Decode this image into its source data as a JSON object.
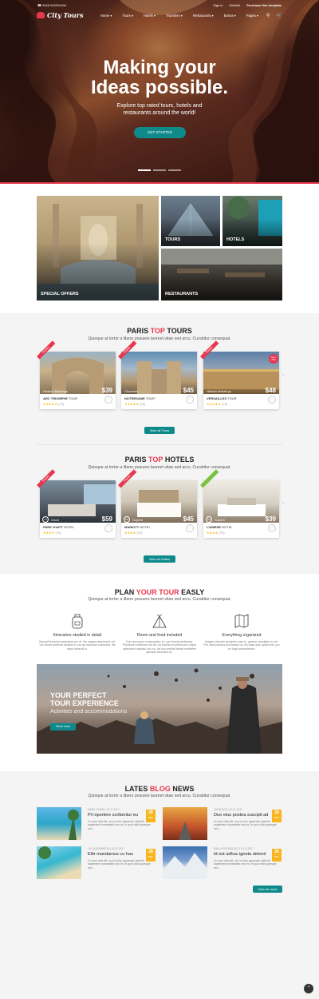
{
  "topbar": {
    "phone": "☎ 0045 043204434",
    "links": [
      "Sign in",
      "Wishlist",
      "Purchase this template"
    ]
  },
  "logo": {
    "text": "City Tours"
  },
  "menu": [
    "Home ▾",
    "Tours ▾",
    "Hotels ▾",
    "Transfers ▾",
    "Restaurants ▾",
    "Bonus ▾",
    "Pages ▾"
  ],
  "hero": {
    "title_1": "Making your",
    "title_2": "Ideas possible.",
    "sub": "Explore top rated tours, hotels and restaurants around the world!",
    "button": "GET STARTED"
  },
  "categories": [
    "Special offers",
    "Tours",
    "Hotels",
    "Restaurants"
  ],
  "tours": {
    "title_a": "PARIS ",
    "title_b": "TOP",
    "title_c": " TOURS",
    "sub": "Quisque at tortor a libero posuere laoreet vitae sed arcu. Curabitur consequat.",
    "cards": [
      {
        "cat": "Historic Buildings",
        "price": "$39",
        "name": "ARC TRIOMPHE",
        "kind": "TOUR",
        "count": "(75)"
      },
      {
        "cat": "Churches",
        "price": "$45",
        "name": "NOTREDAME",
        "kind": "TOUR",
        "count": "(75)"
      },
      {
        "cat": "Historic Buildings",
        "price": "$48",
        "name": "VERSAILLES",
        "kind": "TOUR",
        "count": "(75)"
      }
    ],
    "button": "View all Tours",
    "ribbon": "Popular",
    "badge": "Save 20%"
  },
  "hotels": {
    "title_a": "PARIS ",
    "title_b": "TOP",
    "title_c": " HOTELS",
    "sub": "Quisque at tortor a libero posuere laoreet vitae sed arcu. Curabitur consequat.",
    "cards": [
      {
        "score": "7.5",
        "rank": "Good",
        "price": "$59",
        "name": "PARK HYATT",
        "kind": "HOTEL",
        "count": "(75)"
      },
      {
        "score": "8.5",
        "rank": "Superb",
        "price": "$45",
        "name": "MARIOTT",
        "kind": "HOTEL",
        "count": "(75)"
      },
      {
        "score": "9.0",
        "rank": "Superb",
        "price": "$39",
        "name": "LUMIERE",
        "kind": "HOTEL",
        "count": "(75)"
      }
    ],
    "button": "View all Hotels"
  },
  "plan": {
    "title_a": "PLAN ",
    "title_b": "YOUR TOUR",
    "title_c": " EASLY",
    "sub": "Quisque at tortor a libero posuere laoreet vitae sed arcu. Curabitur consequat.",
    "features": [
      {
        "title": "Itineraries studied in detail",
        "text": "Suscipit invenire petentium per ut. Ne magna assueverit vel. Vix movet perfecto facilisis in, ius ad maiorum corrumpit, his esse docendi in."
      },
      {
        "title": "Room and food included",
        "text": "Cum accusam consequatur at, cum forest pertinacia. Posidonii scribentur his ad, ea lucilius erroribus sed, idque admodum adipisci usu no. Ad usu animal dicant veritatem apeirian electram ex."
      },
      {
        "title": "Everything organized",
        "text": "Integre vivendo percipitur eam in, graece suavitate cu vel. Per inani persius accumsan no. An case duis option est, pro ex fugit consectetuer."
      }
    ]
  },
  "promo": {
    "title_1": "YOUR PERFECT",
    "title_2": "TOUR EXPERIENCE",
    "sub": "Activities and accommodations",
    "button": "Read more"
  },
  "blog": {
    "title_a": "LATES ",
    "title_b": "BLOG",
    "title_c": " NEWS",
    "sub": "Quisque at tortor a libero posuere laoreet vitae sed arcu. Curabitur consequat.",
    "posts": [
      {
        "day": "28",
        "month": "DEC",
        "meta": "MARK TWAIN | 20.11.2017",
        "title": "Pri oportere scribentur eu",
        "text": "Cu eum alia elit, usu in eius appareat, deleniti sapientem honestatis eos ex, in quot vidit quaeque nec..."
      },
      {
        "day": "28",
        "month": "DEC",
        "meta": "JHON DOE | 20.11.2017",
        "title": "Duo eius postea suscipit ad",
        "text": "Cu eum alia elit, usu in eius appareat, deleniti sapientem honestatis eos ex, in quot vidit quaeque nec..."
      },
      {
        "day": "28",
        "month": "DEC",
        "meta": "LUCA ROBINSON | 20.11.2017",
        "title": "Elitr mandamus cu has",
        "text": "Cu eum alia elit, usu in eius appareat, deleniti sapientem honestatis eos ex, in quot vidit quaeque nec..."
      },
      {
        "day": "28",
        "month": "DEC",
        "meta": "PAULA RODRIGUEZ | 20.11.2017",
        "title": "Id est adhuc ignota delenit",
        "text": "Cu eum alia elit, usu in eius appareat, deleniti sapientem honestatis eos ex, in quot vidit quaeque nec..."
      }
    ],
    "button": "View all news"
  },
  "colors": {
    "accent": "#e8384f",
    "teal": "#0e8a8b",
    "yellow": "#f7b520"
  }
}
